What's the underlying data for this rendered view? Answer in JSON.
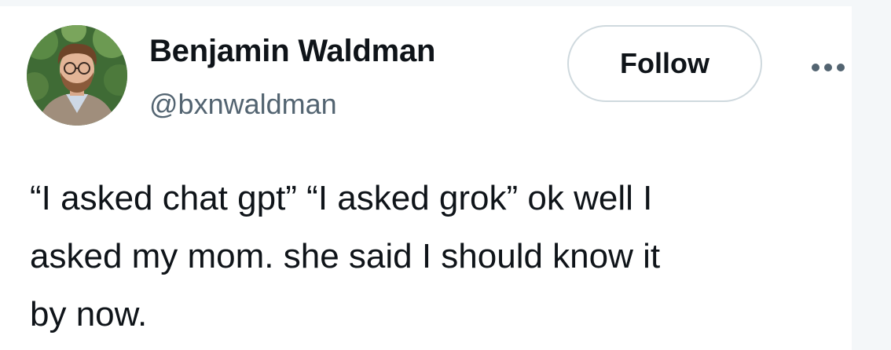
{
  "author": {
    "name": "Benjamin Waldman",
    "handle": "@bxnwaldman",
    "avatar_icon": "profile-photo"
  },
  "actions": {
    "follow_label": "Follow",
    "more_icon": "more-horizontal-icon"
  },
  "tweet": {
    "text": "“I asked chat gpt” “I asked grok” ok well I\nasked my mom. she said I should know it\nby now."
  },
  "colors": {
    "text_primary": "#0f1419",
    "text_secondary": "#536471",
    "border": "#cfd9de",
    "background": "#ffffff"
  }
}
